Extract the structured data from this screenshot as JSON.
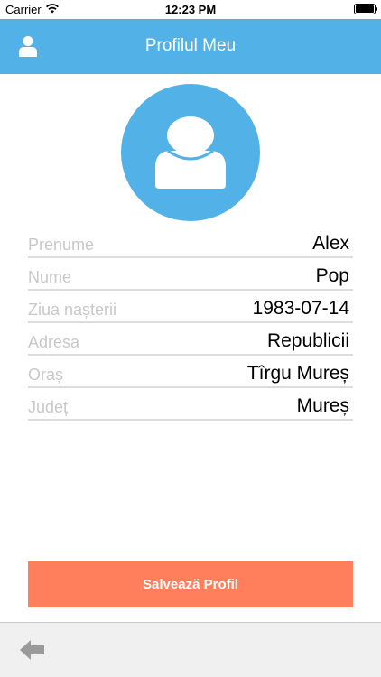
{
  "status_bar": {
    "carrier": "Carrier",
    "time": "12:23 PM",
    "icons": [
      "wifi-icon",
      "battery-icon"
    ]
  },
  "nav": {
    "title": "Profilul Meu",
    "left_icon": "user-icon"
  },
  "avatar": {
    "icon": "user-silhouette-icon",
    "color": "#52b2e7"
  },
  "profile_fields": [
    {
      "label": "Prenume",
      "value": "Alex"
    },
    {
      "label": "Nume",
      "value": "Pop"
    },
    {
      "label": "Ziua nașterii",
      "value": "1983-07-14"
    },
    {
      "label": "Adresa",
      "value": "Republicii"
    },
    {
      "label": "Oraș",
      "value": "Tîrgu Mureș"
    },
    {
      "label": "Județ",
      "value": "Mureș"
    }
  ],
  "save_button": {
    "label": "Salvează Profil",
    "color": "#ff7f5c"
  },
  "toolbar": {
    "back_icon": "back-arrow-icon"
  },
  "colors": {
    "accent": "#52b2e7",
    "button": "#ff7f5c",
    "label_gray": "#c8c8c8",
    "divider": "#dcdcdc"
  }
}
